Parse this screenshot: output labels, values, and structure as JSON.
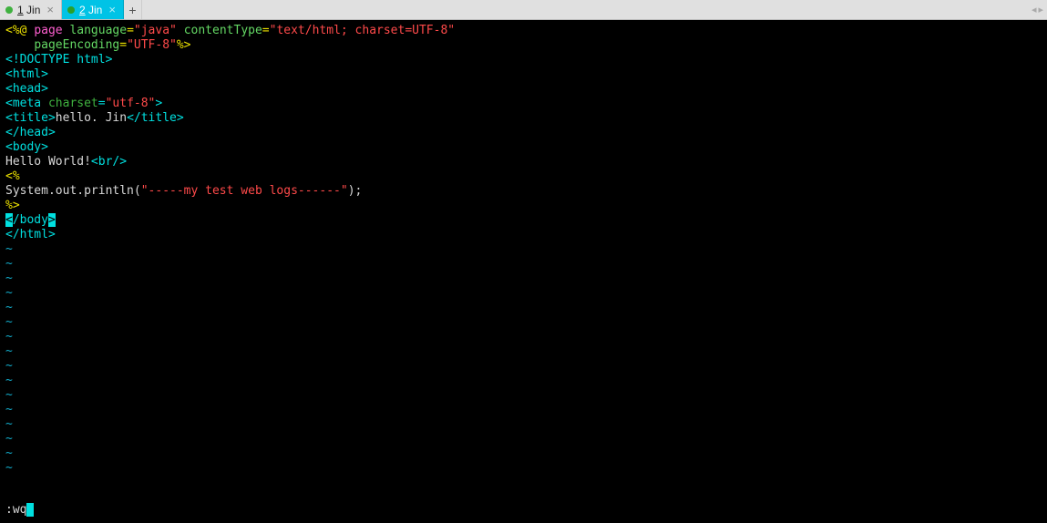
{
  "tabs": {
    "tab1": {
      "num": "1",
      "name": "Jin"
    },
    "tab2": {
      "num": "2",
      "name": "Jin"
    },
    "newtab": "+",
    "nav_left": "◂",
    "nav_right": "▸"
  },
  "code": {
    "l1_open": "<%@ ",
    "l1_page": "page",
    "l1_sp1": " ",
    "l1_lang": "language",
    "l1_eq1": "=",
    "l1_langv": "\"java\"",
    "l1_sp2": " ",
    "l1_ctyp": "contentType",
    "l1_eq2": "=",
    "l1_ctypv": "\"text/html; charset=UTF-8\"",
    "l2_indent": "    ",
    "l2_penc": "pageEncoding",
    "l2_eq": "=",
    "l2_pencv": "\"UTF-8\"",
    "l2_close": "%>",
    "l3": "<!DOCTYPE html>",
    "l4": "<html>",
    "l5": "<head>",
    "l6_open": "<meta",
    "l6_sp": " ",
    "l6_attr": "charset",
    "l6_eq": "=",
    "l6_val": "\"utf-8\"",
    "l6_close": ">",
    "l7_open": "<title>",
    "l7_text": "hello. Jin",
    "l7_close": "</title>",
    "l8": "</head>",
    "l9": "<body>",
    "l10_text": "Hello World!",
    "l10_br": "<br/>",
    "l11": "<%",
    "l12_pre": "System.out.println(",
    "l12_str": "\"-----my test web logs------\"",
    "l12_post": ");",
    "l13": "%>",
    "l14_lt": "<",
    "l14_body": "/body",
    "l14_gt": ">",
    "l15": "</html>",
    "tilde": "~"
  },
  "cmd": {
    "text": ":wq"
  }
}
